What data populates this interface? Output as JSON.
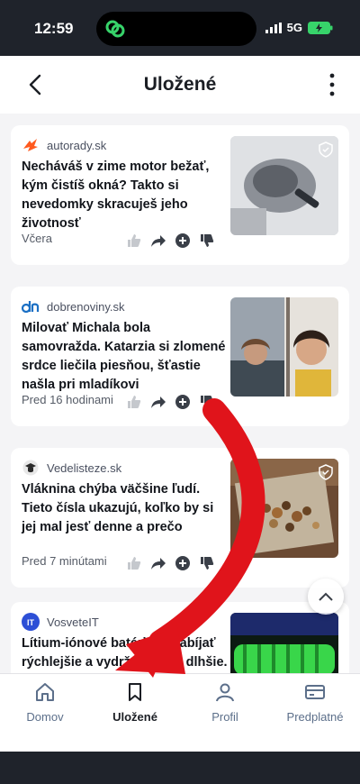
{
  "status": {
    "time": "12:59",
    "network": "5G"
  },
  "header": {
    "title": "Uložené"
  },
  "articles": [
    {
      "source": "autorady.sk",
      "headline": "Necháváš v zime motor bežať, kým čistíš okná? Takto si nevedomky skracuješ jeho životnosť",
      "time": "Včera"
    },
    {
      "source": "dobrenoviny.sk",
      "headline": "Milovať Michala bola samovražda. Katarzia si zlomené srdce liečila piesňou, šťastie našla pri mladíkovi",
      "time": "Pred 16 hodinami"
    },
    {
      "source": "Vedelisteze.sk",
      "headline": "Vláknina chýba väčšine ľudí. Tieto čísla ukazujú, koľko by si jej mal jesť denne a prečo",
      "time": "Pred 7 minútami"
    },
    {
      "source": "VosveteIT",
      "headline": "Lítium-iónové batérie ... nabíjať rýchlejšie a vydržať oveľa dlhšie. ..."
    }
  ],
  "nav": [
    {
      "label": "Domov",
      "icon": "home-icon"
    },
    {
      "label": "Uložené",
      "icon": "bookmark-icon",
      "active": true
    },
    {
      "label": "Profil",
      "icon": "profile-icon"
    },
    {
      "label": "Predplatné",
      "icon": "subscription-icon"
    }
  ],
  "colors": {
    "accent_red": "#e0141b",
    "background": "#f4f4f6",
    "dark_bar": "#1f232b"
  }
}
